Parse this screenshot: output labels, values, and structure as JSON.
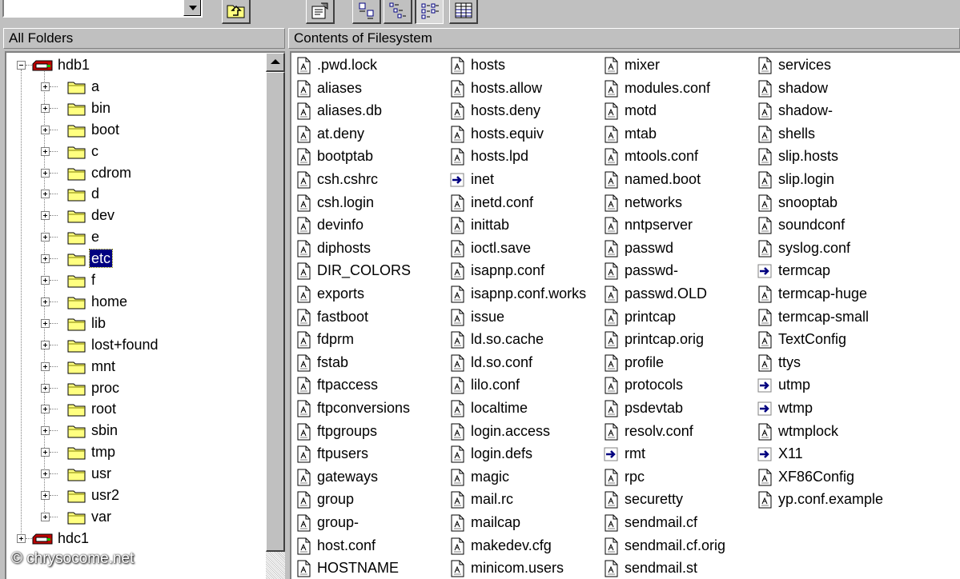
{
  "toolbar": {
    "address_value": "",
    "buttons": [
      {
        "name": "up-one-level-button",
        "icon": "folder-up-icon"
      },
      {
        "name": "properties-button",
        "icon": "properties-icon"
      },
      {
        "name": "large-icons-view-button",
        "icon": "large-icons-icon"
      },
      {
        "name": "small-icons-view-button",
        "icon": "small-icons-icon"
      },
      {
        "name": "list-view-button",
        "icon": "list-view-icon"
      },
      {
        "name": "details-view-button",
        "icon": "details-view-icon"
      }
    ]
  },
  "folder_pane": {
    "header": "All Folders",
    "tree": [
      {
        "label": "hdb1",
        "type": "drive",
        "expander": "minus",
        "level": 0
      },
      {
        "label": "a",
        "type": "folder",
        "expander": "plus",
        "level": 1
      },
      {
        "label": "bin",
        "type": "folder",
        "expander": "plus",
        "level": 1
      },
      {
        "label": "boot",
        "type": "folder",
        "expander": "plus",
        "level": 1
      },
      {
        "label": "c",
        "type": "folder",
        "expander": "plus",
        "level": 1
      },
      {
        "label": "cdrom",
        "type": "folder",
        "expander": "plus",
        "level": 1
      },
      {
        "label": "d",
        "type": "folder",
        "expander": "plus",
        "level": 1
      },
      {
        "label": "dev",
        "type": "folder",
        "expander": "plus",
        "level": 1
      },
      {
        "label": "e",
        "type": "folder",
        "expander": "plus",
        "level": 1
      },
      {
        "label": "etc",
        "type": "folder",
        "expander": "plus",
        "level": 1,
        "selected": true
      },
      {
        "label": "f",
        "type": "folder",
        "expander": "plus",
        "level": 1
      },
      {
        "label": "home",
        "type": "folder",
        "expander": "plus",
        "level": 1
      },
      {
        "label": "lib",
        "type": "folder",
        "expander": "plus",
        "level": 1
      },
      {
        "label": "lost+found",
        "type": "folder",
        "expander": "plus",
        "level": 1
      },
      {
        "label": "mnt",
        "type": "folder",
        "expander": "plus",
        "level": 1
      },
      {
        "label": "proc",
        "type": "folder",
        "expander": "plus",
        "level": 1
      },
      {
        "label": "root",
        "type": "folder",
        "expander": "plus",
        "level": 1
      },
      {
        "label": "sbin",
        "type": "folder",
        "expander": "plus",
        "level": 1
      },
      {
        "label": "tmp",
        "type": "folder",
        "expander": "plus",
        "level": 1
      },
      {
        "label": "usr",
        "type": "folder",
        "expander": "plus",
        "level": 1
      },
      {
        "label": "usr2",
        "type": "folder",
        "expander": "plus",
        "level": 1
      },
      {
        "label": "var",
        "type": "folder",
        "expander": "plus",
        "level": 1
      },
      {
        "label": "hdc1",
        "type": "drive",
        "expander": "plus",
        "level": 0
      }
    ]
  },
  "content_pane": {
    "header": "Contents of Filesystem",
    "columns": [
      [
        {
          "name": ".pwd.lock",
          "icon": "file"
        },
        {
          "name": "aliases",
          "icon": "file"
        },
        {
          "name": "aliases.db",
          "icon": "file"
        },
        {
          "name": "at.deny",
          "icon": "file"
        },
        {
          "name": "bootptab",
          "icon": "file"
        },
        {
          "name": "csh.cshrc",
          "icon": "file"
        },
        {
          "name": "csh.login",
          "icon": "file"
        },
        {
          "name": "devinfo",
          "icon": "file"
        },
        {
          "name": "diphosts",
          "icon": "file"
        },
        {
          "name": "DIR_COLORS",
          "icon": "file"
        },
        {
          "name": "exports",
          "icon": "file"
        },
        {
          "name": "fastboot",
          "icon": "file"
        },
        {
          "name": "fdprm",
          "icon": "file"
        },
        {
          "name": "fstab",
          "icon": "file"
        },
        {
          "name": "ftpaccess",
          "icon": "file"
        },
        {
          "name": "ftpconversions",
          "icon": "file"
        },
        {
          "name": "ftpgroups",
          "icon": "file"
        },
        {
          "name": "ftpusers",
          "icon": "file"
        },
        {
          "name": "gateways",
          "icon": "file"
        },
        {
          "name": "group",
          "icon": "file"
        },
        {
          "name": "group-",
          "icon": "file"
        },
        {
          "name": "host.conf",
          "icon": "file"
        },
        {
          "name": "HOSTNAME",
          "icon": "file"
        }
      ],
      [
        {
          "name": "hosts",
          "icon": "file"
        },
        {
          "name": "hosts.allow",
          "icon": "file"
        },
        {
          "name": "hosts.deny",
          "icon": "file"
        },
        {
          "name": "hosts.equiv",
          "icon": "file"
        },
        {
          "name": "hosts.lpd",
          "icon": "file"
        },
        {
          "name": "inet",
          "icon": "link"
        },
        {
          "name": "inetd.conf",
          "icon": "file"
        },
        {
          "name": "inittab",
          "icon": "file"
        },
        {
          "name": "ioctl.save",
          "icon": "file"
        },
        {
          "name": "isapnp.conf",
          "icon": "file"
        },
        {
          "name": "isapnp.conf.works",
          "icon": "file"
        },
        {
          "name": "issue",
          "icon": "file"
        },
        {
          "name": "ld.so.cache",
          "icon": "file"
        },
        {
          "name": "ld.so.conf",
          "icon": "file"
        },
        {
          "name": "lilo.conf",
          "icon": "file"
        },
        {
          "name": "localtime",
          "icon": "file"
        },
        {
          "name": "login.access",
          "icon": "file"
        },
        {
          "name": "login.defs",
          "icon": "file"
        },
        {
          "name": "magic",
          "icon": "file"
        },
        {
          "name": "mail.rc",
          "icon": "file"
        },
        {
          "name": "mailcap",
          "icon": "file"
        },
        {
          "name": "makedev.cfg",
          "icon": "file"
        },
        {
          "name": "minicom.users",
          "icon": "file"
        }
      ],
      [
        {
          "name": "mixer",
          "icon": "file"
        },
        {
          "name": "modules.conf",
          "icon": "file"
        },
        {
          "name": "motd",
          "icon": "file"
        },
        {
          "name": "mtab",
          "icon": "file"
        },
        {
          "name": "mtools.conf",
          "icon": "file"
        },
        {
          "name": "named.boot",
          "icon": "file"
        },
        {
          "name": "networks",
          "icon": "file"
        },
        {
          "name": "nntpserver",
          "icon": "file"
        },
        {
          "name": "passwd",
          "icon": "file"
        },
        {
          "name": "passwd-",
          "icon": "file"
        },
        {
          "name": "passwd.OLD",
          "icon": "file"
        },
        {
          "name": "printcap",
          "icon": "file"
        },
        {
          "name": "printcap.orig",
          "icon": "file"
        },
        {
          "name": "profile",
          "icon": "file"
        },
        {
          "name": "protocols",
          "icon": "file"
        },
        {
          "name": "psdevtab",
          "icon": "file"
        },
        {
          "name": "resolv.conf",
          "icon": "file"
        },
        {
          "name": "rmt",
          "icon": "link"
        },
        {
          "name": "rpc",
          "icon": "file"
        },
        {
          "name": "securetty",
          "icon": "file"
        },
        {
          "name": "sendmail.cf",
          "icon": "file"
        },
        {
          "name": "sendmail.cf.orig",
          "icon": "file"
        },
        {
          "name": "sendmail.st",
          "icon": "file"
        }
      ],
      [
        {
          "name": "services",
          "icon": "file"
        },
        {
          "name": "shadow",
          "icon": "file"
        },
        {
          "name": "shadow-",
          "icon": "file"
        },
        {
          "name": "shells",
          "icon": "file"
        },
        {
          "name": "slip.hosts",
          "icon": "file"
        },
        {
          "name": "slip.login",
          "icon": "file"
        },
        {
          "name": "snooptab",
          "icon": "file"
        },
        {
          "name": "soundconf",
          "icon": "file"
        },
        {
          "name": "syslog.conf",
          "icon": "file"
        },
        {
          "name": "termcap",
          "icon": "link"
        },
        {
          "name": "termcap-huge",
          "icon": "file"
        },
        {
          "name": "termcap-small",
          "icon": "file"
        },
        {
          "name": "TextConfig",
          "icon": "file"
        },
        {
          "name": "ttys",
          "icon": "file"
        },
        {
          "name": "utmp",
          "icon": "link"
        },
        {
          "name": "wtmp",
          "icon": "link"
        },
        {
          "name": "wtmplock",
          "icon": "file"
        },
        {
          "name": "X11",
          "icon": "link"
        },
        {
          "name": "XF86Config",
          "icon": "file"
        },
        {
          "name": "yp.conf.example",
          "icon": "file"
        }
      ]
    ]
  },
  "watermark": "© chrysocome.net",
  "colors": {
    "window_bg": "#c0c0c0",
    "selection_bg": "#000080",
    "folder_yellow": "#ffff80",
    "drive_red": "#c00000",
    "link_arrow": "#000080"
  }
}
